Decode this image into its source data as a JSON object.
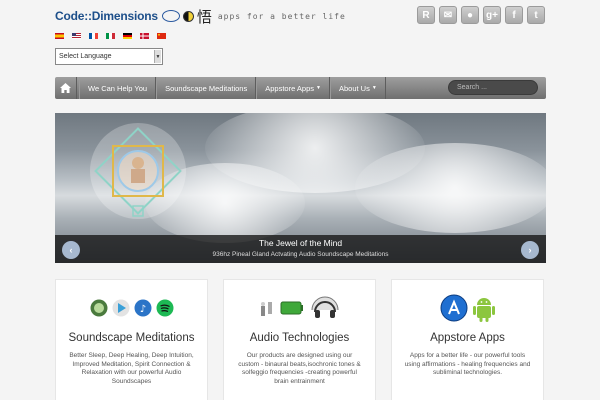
{
  "header": {
    "logo_text": "Code::Dimensions",
    "logo_kanji": "悟",
    "tagline": "apps for a better life"
  },
  "social": [
    {
      "name": "rss-icon",
      "glyph": "R"
    },
    {
      "name": "email-icon",
      "glyph": "✉"
    },
    {
      "name": "location-icon",
      "glyph": "●"
    },
    {
      "name": "google-plus-icon",
      "glyph": "g+"
    },
    {
      "name": "facebook-icon",
      "glyph": "f"
    },
    {
      "name": "twitter-icon",
      "glyph": "t"
    }
  ],
  "language_select": {
    "value": "Select Language"
  },
  "nav": {
    "items": [
      "We Can Help You",
      "Soundscape Meditations",
      "Appstore Apps",
      "About Us"
    ],
    "search_placeholder": "Search ..."
  },
  "slider": {
    "title": "The Jewel of the Mind",
    "subtitle": "936hz Pineal Gland Actvating Audio Soundscape Meditations"
  },
  "features": [
    {
      "title": "Soundscape Meditations",
      "text": "Better Sleep, Deep Healing, Deep Intuition, Improved Meditation, Spirit Connection & Relaxation with our powerful Audio Soundscapes"
    },
    {
      "title": "Audio Technologies",
      "text": "Our products are designed using our custom - binaural beats,isochronic tones & solfeggio frequencies -creating powerful brain entrainment"
    },
    {
      "title": "Appstore Apps",
      "text": "Apps for a better life - our powerful tools using affirmations - healing frequencies and subliminal technologies."
    }
  ]
}
